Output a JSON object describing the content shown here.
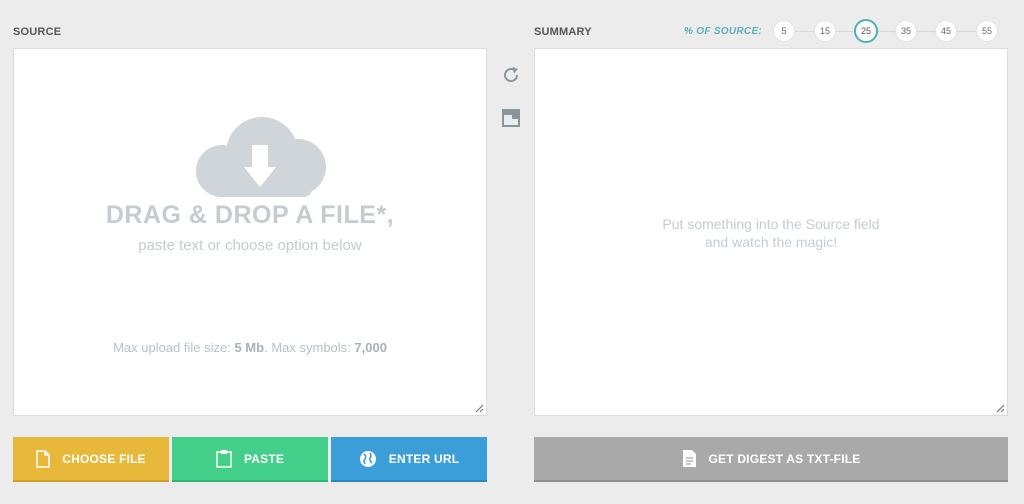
{
  "source": {
    "label": "SOURCE",
    "drag_title": "DRAG & DROP A FILE*,",
    "drag_subtitle": "paste text or choose option below",
    "limits_prefix": "Max upload file size: ",
    "limits_size": "5 Mb",
    "limits_middle": ". Max symbols: ",
    "limits_symbols": "7,000"
  },
  "summary": {
    "label": "SUMMARY",
    "hint_line1": "Put something into the Source field",
    "hint_line2": "and watch the magic!"
  },
  "percent": {
    "label": "% OF SOURCE:",
    "options": [
      "5",
      "15",
      "25",
      "35",
      "45",
      "55"
    ],
    "selected": "25",
    "accent": "#4ab1b7"
  },
  "buttons": {
    "choose_file": "CHOOSE FILE",
    "paste": "PASTE",
    "enter_url": "ENTER URL",
    "get_digest": "GET DIGEST AS TXT-FILE"
  },
  "icons": {
    "upload": "cloud-download-icon",
    "refresh": "refresh-icon",
    "expand": "expand-window-icon",
    "file": "file-icon",
    "clipboard": "clipboard-icon",
    "globe": "globe-icon",
    "document": "document-icon"
  },
  "colors": {
    "choose": "#e8b83a",
    "paste": "#44d08a",
    "url": "#3c9ed9",
    "digest": "#a9a9a9"
  }
}
